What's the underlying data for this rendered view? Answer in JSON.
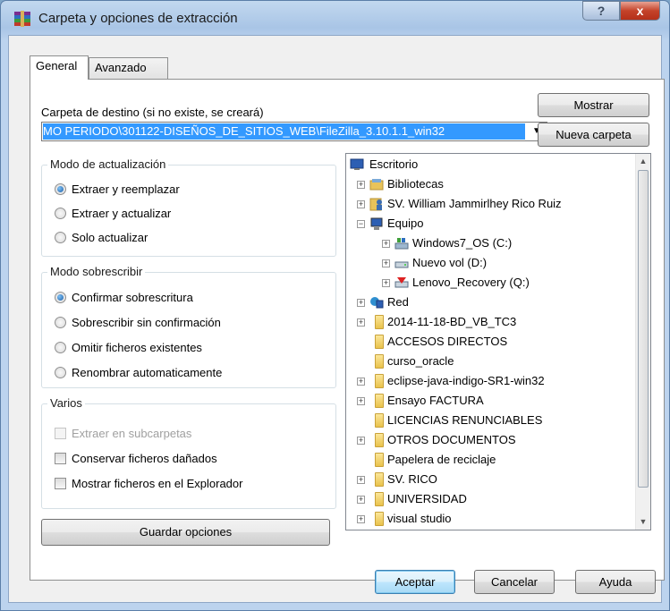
{
  "window": {
    "title": "Carpeta y opciones de extracción",
    "help_label": "?",
    "close_label": "x"
  },
  "tabs": {
    "general": "General",
    "advanced": "Avanzado"
  },
  "destination": {
    "label": "Carpeta de destino (si no existe, se creará)",
    "value": "MO PERIODO\\301122-DISEÑOS_DE_SITIOS_WEB\\FileZilla_3.10.1.1_win32",
    "show_button": "Mostrar",
    "new_folder_button": "Nueva carpeta"
  },
  "update_mode": {
    "title": "Modo de actualización",
    "options": [
      {
        "label": "Extraer y reemplazar",
        "selected": true
      },
      {
        "label": "Extraer y actualizar",
        "selected": false
      },
      {
        "label": "Solo actualizar",
        "selected": false
      }
    ]
  },
  "overwrite_mode": {
    "title": "Modo sobrescribir",
    "options": [
      {
        "label": "Confirmar sobrescritura",
        "selected": true
      },
      {
        "label": "Sobrescribir sin confirmación",
        "selected": false
      },
      {
        "label": "Omitir ficheros existentes",
        "selected": false
      },
      {
        "label": "Renombrar automaticamente",
        "selected": false
      }
    ]
  },
  "misc": {
    "title": "Varios",
    "options": [
      {
        "label": "Extraer en subcarpetas",
        "checked": false,
        "disabled": true
      },
      {
        "label": "Conservar ficheros dañados",
        "checked": false,
        "disabled": false
      },
      {
        "label": "Mostrar ficheros en el Explorador",
        "checked": false,
        "disabled": false
      }
    ]
  },
  "save_button": "Guardar opciones",
  "tree": {
    "items": [
      {
        "label": "Escritorio",
        "icon": "desktop-icon"
      },
      {
        "label": "Bibliotecas",
        "icon": "library-icon"
      },
      {
        "label": "SV. William Jammirlhey Rico Ruiz",
        "icon": "user-icon"
      },
      {
        "label": "Equipo",
        "icon": "computer-icon"
      },
      {
        "label": "Windows7_OS (C:)",
        "icon": "drive-icon"
      },
      {
        "label": "Nuevo vol (D:)",
        "icon": "drive-icon"
      },
      {
        "label": "Lenovo_Recovery (Q:)",
        "icon": "recovery-drive-icon"
      },
      {
        "label": "Red",
        "icon": "network-icon"
      },
      {
        "label": "2014-11-18-BD_VB_TC3",
        "icon": "folder-icon"
      },
      {
        "label": "ACCESOS DIRECTOS",
        "icon": "folder-icon"
      },
      {
        "label": "curso_oracle",
        "icon": "folder-icon"
      },
      {
        "label": "eclipse-java-indigo-SR1-win32",
        "icon": "folder-icon"
      },
      {
        "label": "Ensayo FACTURA",
        "icon": "folder-icon"
      },
      {
        "label": "LICENCIAS RENUNCIABLES",
        "icon": "folder-icon"
      },
      {
        "label": "OTROS DOCUMENTOS",
        "icon": "folder-icon"
      },
      {
        "label": "Papelera de reciclaje",
        "icon": "folder-icon"
      },
      {
        "label": "SV. RICO",
        "icon": "folder-icon"
      },
      {
        "label": "UNIVERSIDAD",
        "icon": "folder-icon"
      },
      {
        "label": "visual studio",
        "icon": "folder-icon"
      }
    ]
  },
  "footer": {
    "ok": "Aceptar",
    "cancel": "Cancelar",
    "help": "Ayuda"
  }
}
